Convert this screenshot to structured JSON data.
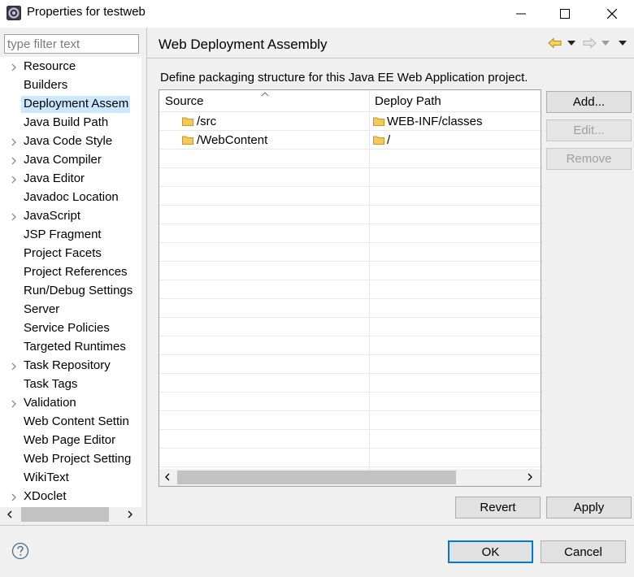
{
  "window": {
    "title": "Properties for testweb",
    "icons": {
      "app": "eclipse-gear-icon",
      "minimize": "minimize-icon",
      "maximize": "maximize-icon",
      "close": "close-icon"
    }
  },
  "filter": {
    "placeholder": "type filter text",
    "value": ""
  },
  "tree": {
    "items": [
      {
        "label": "Resource",
        "expandable": true
      },
      {
        "label": "Builders",
        "expandable": false
      },
      {
        "label": "Deployment Assem",
        "expandable": false,
        "selected": true
      },
      {
        "label": "Java Build Path",
        "expandable": false
      },
      {
        "label": "Java Code Style",
        "expandable": true
      },
      {
        "label": "Java Compiler",
        "expandable": true
      },
      {
        "label": "Java Editor",
        "expandable": true
      },
      {
        "label": "Javadoc Location",
        "expandable": false
      },
      {
        "label": "JavaScript",
        "expandable": true
      },
      {
        "label": "JSP Fragment",
        "expandable": false
      },
      {
        "label": "Project Facets",
        "expandable": false
      },
      {
        "label": "Project References",
        "expandable": false
      },
      {
        "label": "Run/Debug Settings",
        "expandable": false
      },
      {
        "label": "Server",
        "expandable": false
      },
      {
        "label": "Service Policies",
        "expandable": false
      },
      {
        "label": "Targeted Runtimes",
        "expandable": false
      },
      {
        "label": "Task Repository",
        "expandable": true
      },
      {
        "label": "Task Tags",
        "expandable": false
      },
      {
        "label": "Validation",
        "expandable": true
      },
      {
        "label": "Web Content Settin",
        "expandable": false
      },
      {
        "label": "Web Page Editor",
        "expandable": false
      },
      {
        "label": "Web Project Setting",
        "expandable": false
      },
      {
        "label": "WikiText",
        "expandable": false
      },
      {
        "label": "XDoclet",
        "expandable": true
      }
    ]
  },
  "page": {
    "title": "Web Deployment Assembly",
    "nav_icons": [
      "back-arrow-icon",
      "dropdown-icon",
      "forward-arrow-icon",
      "dropdown-icon",
      "view-menu-icon"
    ],
    "description": "Define packaging structure for this Java EE Web Application project."
  },
  "table": {
    "columns": [
      "Source",
      "Deploy Path"
    ],
    "rows": [
      {
        "source": "/src",
        "deploy": "WEB-INF/classes"
      },
      {
        "source": "/WebContent",
        "deploy": "/"
      }
    ]
  },
  "side_buttons": {
    "add": "Add...",
    "edit": "Edit...",
    "remove": "Remove"
  },
  "footer": {
    "revert": "Revert",
    "apply": "Apply",
    "ok": "OK",
    "cancel": "Cancel"
  },
  "colors": {
    "selection": "#cce8ff",
    "default_button_border": "#0078d7",
    "folder": "#e8b84a"
  }
}
